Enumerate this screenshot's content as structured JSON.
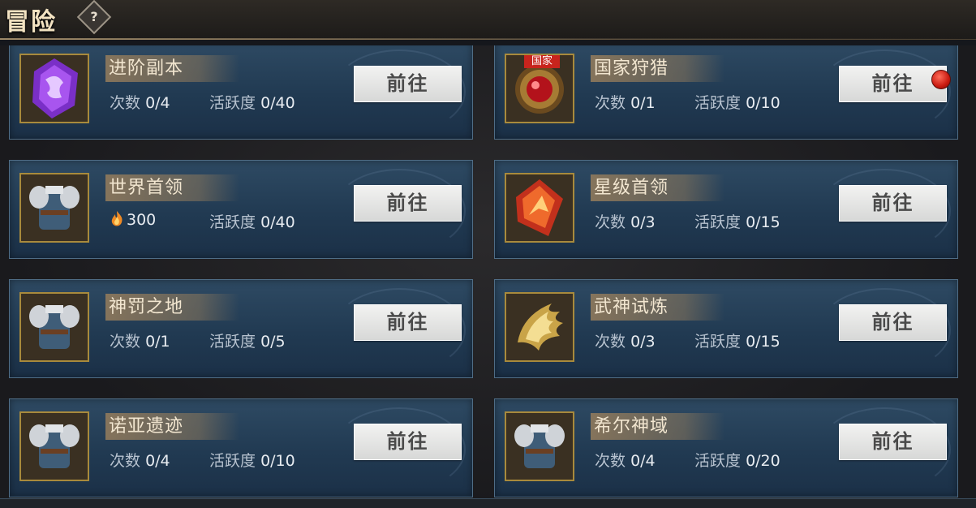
{
  "header": {
    "title": "冒险",
    "help_symbol": "?"
  },
  "cards": [
    {
      "name": "进阶副本",
      "stat1_label": "次数",
      "stat1_value": "0/4",
      "stat2_label": "活跃度",
      "stat2_value": "0/40",
      "button": "前往",
      "icon": "purple-dragon-crystal-icon"
    },
    {
      "name": "国家狩猎",
      "stat1_label": "次数",
      "stat1_value": "0/1",
      "stat2_label": "活跃度",
      "stat2_value": "0/10",
      "button": "前往",
      "icon": "red-gem-emblem-icon",
      "tag": "国家",
      "has_notification": true
    },
    {
      "name": "世界首领",
      "stat1_value": "300",
      "stat2_label": "活跃度",
      "stat2_value": "0/40",
      "button": "前往",
      "icon": "armor-icon",
      "cost_icon": "flame-currency-icon"
    },
    {
      "name": "星级首领",
      "stat1_label": "次数",
      "stat1_value": "0/3",
      "stat2_label": "活跃度",
      "stat2_value": "0/15",
      "button": "前往",
      "icon": "red-crystal-shard-icon"
    },
    {
      "name": "神罚之地",
      "stat1_label": "次数",
      "stat1_value": "0/1",
      "stat2_label": "活跃度",
      "stat2_value": "0/5",
      "button": "前往",
      "icon": "armor-icon"
    },
    {
      "name": "武神试炼",
      "stat1_label": "次数",
      "stat1_value": "0/3",
      "stat2_label": "活跃度",
      "stat2_value": "0/15",
      "button": "前往",
      "icon": "golden-wing-icon"
    },
    {
      "name": "诺亚遗迹",
      "stat1_label": "次数",
      "stat1_value": "0/4",
      "stat2_label": "活跃度",
      "stat2_value": "0/10",
      "button": "前往",
      "icon": "armor-icon"
    },
    {
      "name": "希尔神域",
      "stat1_label": "次数",
      "stat1_value": "0/4",
      "stat2_label": "活跃度",
      "stat2_value": "0/20",
      "button": "前往",
      "icon": "armor-icon"
    }
  ],
  "colors": {
    "accent_gold": "#a88a3c",
    "card_blue": "#213a52",
    "notification_red": "#c91a10"
  }
}
